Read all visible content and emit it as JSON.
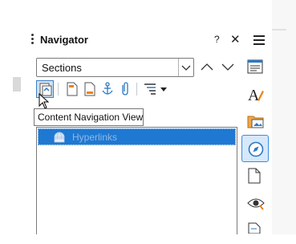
{
  "navigator": {
    "title": "Navigator",
    "help_label": "?",
    "close_label": "✕",
    "category_select": {
      "value": "Sections"
    },
    "tooltip": "Content Navigation View",
    "tree": {
      "items": [
        {
          "label": "Hyperlinks"
        }
      ]
    }
  },
  "colors": {
    "selection": "#1f78d1",
    "accent": "#2b78c4",
    "active_button_bg": "#cfe2f5"
  },
  "icons": {
    "toolbar": [
      "content-navigation-view-icon",
      "header-icon",
      "footer-icon",
      "anchor-icon",
      "attachment-icon",
      "heading-levels-icon",
      "dropdown-arrow-icon"
    ],
    "sidebar": [
      "properties-icon",
      "styles-icon",
      "gallery-icon",
      "navigator-icon",
      "page-icon",
      "style-inspector-icon",
      "manage-changes-icon"
    ]
  }
}
